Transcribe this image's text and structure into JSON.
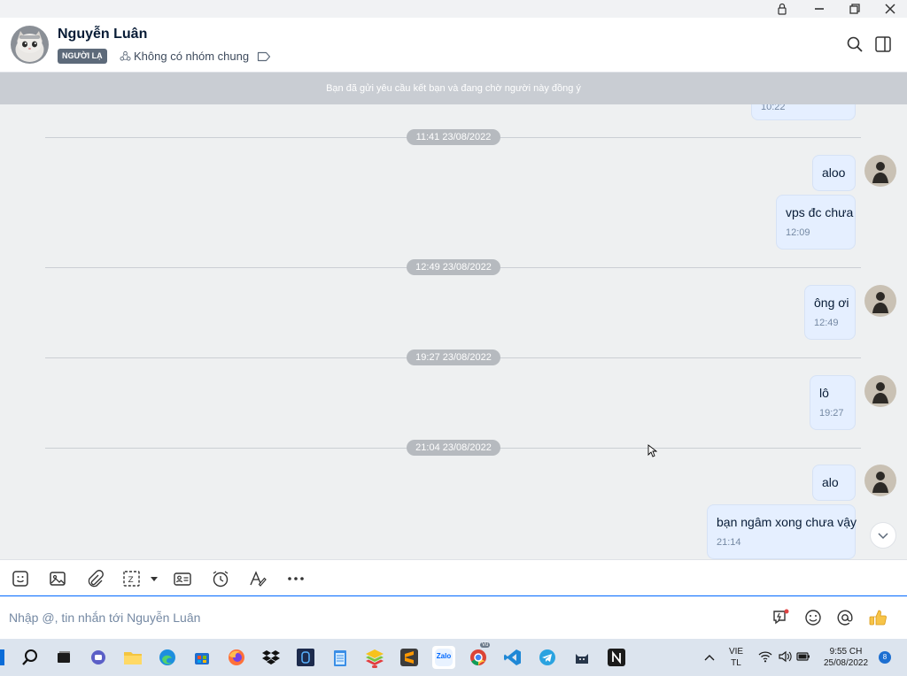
{
  "header": {
    "contact_name": "Nguyễn Luân",
    "badge": "NGƯỜI LẠ",
    "mutual_groups": "Không có nhóm chung"
  },
  "banner": {
    "text": "Bạn đã gửi yêu cầu kết bạn và đang chờ người này đồng ý"
  },
  "chat": {
    "partial_time": "10:22",
    "dividers": [
      "11:41 23/08/2022",
      "12:49 23/08/2022",
      "19:27 23/08/2022",
      "21:04 23/08/2022"
    ],
    "messages": [
      {
        "text": "aloo",
        "time": ""
      },
      {
        "text": "vps đc chưa",
        "time": "12:09"
      },
      {
        "text": "ông ơi",
        "time": "12:49"
      },
      {
        "text": "lô",
        "time": "19:27"
      },
      {
        "text": "alo",
        "time": ""
      },
      {
        "text": "bạn ngâm xong chưa vậy",
        "time": "21:14"
      }
    ]
  },
  "input": {
    "placeholder": "Nhập @, tin nhắn tới Nguyễn Luân"
  },
  "taskbar": {
    "lang_top": "VIE",
    "lang_bottom": "TL",
    "clock_time": "9:55 CH",
    "clock_date": "25/08/2022",
    "notification_count": "8",
    "chrome_badge": "Vũ",
    "zalo_label": "Zalo"
  },
  "colors": {
    "accent": "#0068ff",
    "bubble_bg": "#e5efff",
    "chat_bg": "#eef0f1",
    "banner_bg": "#c9cdd3",
    "time_pill": "#b6babf"
  },
  "icons": {
    "window": [
      "lock-icon",
      "minimize-icon",
      "restore-icon",
      "close-icon"
    ],
    "header": [
      "search-icon",
      "sidebar-toggle-icon"
    ],
    "toolbar": [
      "sticker-icon",
      "image-icon",
      "attachment-icon",
      "screenshot-icon",
      "contact-card-icon",
      "reminder-icon",
      "text-format-icon",
      "more-icon"
    ],
    "input": [
      "quick-message-icon",
      "emoji-icon",
      "mention-icon",
      "thumbs-up-icon"
    ]
  }
}
